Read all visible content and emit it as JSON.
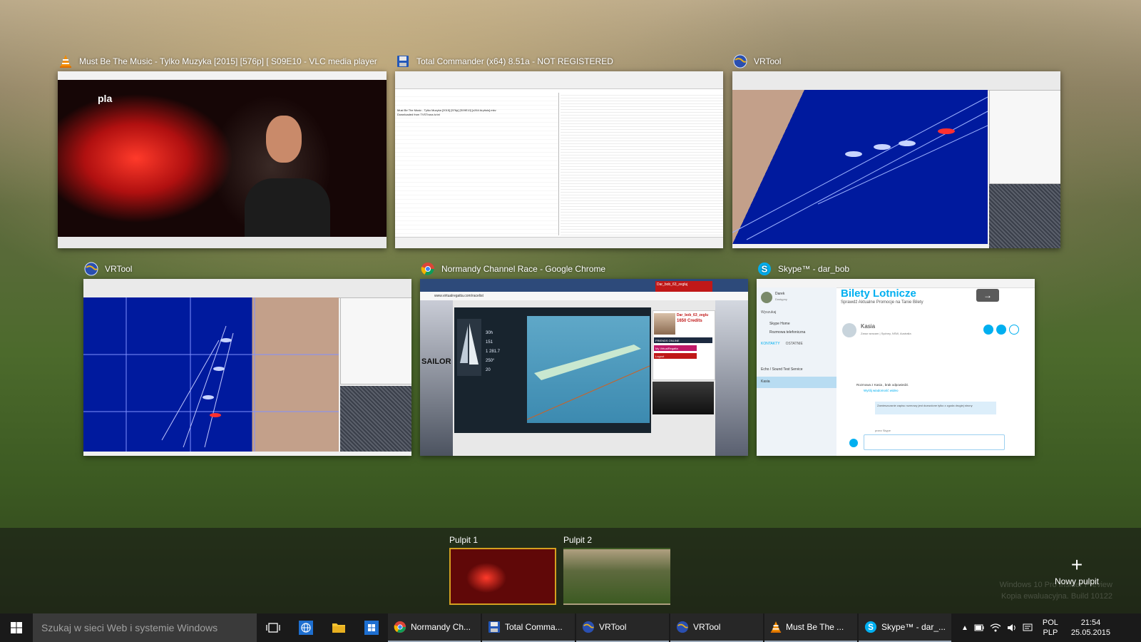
{
  "windows": [
    {
      "id": "vlc",
      "title": "Must Be The Music - Tylko Muzyka [2015] [576p] [ S09E10 - VLC media player",
      "icon": "vlc-cone-icon"
    },
    {
      "id": "tc",
      "title": "Total Commander (x64) 8.51a - NOT REGISTERED",
      "icon": "floppy-disk-icon"
    },
    {
      "id": "vr1",
      "title": "VRTool",
      "icon": "vrtool-globe-icon"
    },
    {
      "id": "vr2",
      "title": "VRTool",
      "icon": "vrtool-globe-icon"
    },
    {
      "id": "chrome",
      "title": "Normandy Channel Race - Google Chrome",
      "icon": "chrome-icon"
    },
    {
      "id": "skype",
      "title": "Skype™ - dar_bob",
      "icon": "skype-icon"
    }
  ],
  "vlc_thumb": {
    "channel_logo": "pla"
  },
  "tc_thumb": {
    "file_lines": [
      "Must Be The Music - Tylko Muzyka [2015] [576p] [S09E10] [x264 Aryitulo].mkv",
      "Downloaded from TVSTrona.tv.txt"
    ]
  },
  "chrome_thumb": {
    "url": "www.virtualregatta.com/racelist",
    "tab": "Dar_bob_63_zegluj",
    "player": "Dar_bob_63_zeglu",
    "credits": "1650 Credits",
    "online": "FRIENDS ONLINE",
    "my_vr": "My VirtualRegatta",
    "logout": "Logout",
    "sailor": "SAILOR",
    "instruments": [
      "30h",
      "151",
      "1 281.7",
      "250°",
      "20"
    ]
  },
  "skype_thumb": {
    "banner_title": "Bilety Lotnicze",
    "banner_subtitle": "Sprawdź Aktualne Promocje na Tanie Bilety",
    "contact_name": "Kasia",
    "contact_location": "Zaraz wracam | Sydney, NSW, Australia",
    "user_name": "Darek",
    "user_status": "Dostępny",
    "search": "Wyszukaj",
    "home": "Skype Home",
    "calls": "Rozmowa telefoniczna",
    "tabs": [
      "KONTAKTY",
      "OSTATNIE"
    ],
    "contacts": [
      "Echo / Sound Test Service",
      "Kasia"
    ],
    "message1": "Rozmowa z Kasia , brak odpowiedzi.",
    "message1_link": "Wyślij wiadomość wideo",
    "message2": "Zamieszczanie zapisu rozmowy jest dozwolone tylko z zgoda drugiej strony",
    "compose_label": "przez Skype"
  },
  "desktops": {
    "items": [
      {
        "label": "Pulpit 1",
        "active": true
      },
      {
        "label": "Pulpit 2",
        "active": false
      }
    ],
    "new_label": "Nowy pulpit"
  },
  "watermark": {
    "line1": "Windows 10 Pro Insider Preview",
    "line2": "Kopia ewaluacyjna. Build 10122"
  },
  "taskbar": {
    "search_placeholder": "Szukaj w sieci Web i systemie Windows",
    "apps": [
      {
        "label": "Normandy Ch...",
        "icon": "chrome-icon"
      },
      {
        "label": "Total Comma...",
        "icon": "floppy-disk-icon"
      },
      {
        "label": "VRTool",
        "icon": "vrtool-globe-icon"
      },
      {
        "label": "VRTool",
        "icon": "vrtool-globe-icon"
      },
      {
        "label": "Must Be The ...",
        "icon": "vlc-cone-icon"
      },
      {
        "label": "Skype™ - dar_...",
        "icon": "skype-icon"
      }
    ],
    "lang": "POL",
    "layout": "PLP",
    "time": "21:54",
    "date": "25.05.2015"
  }
}
